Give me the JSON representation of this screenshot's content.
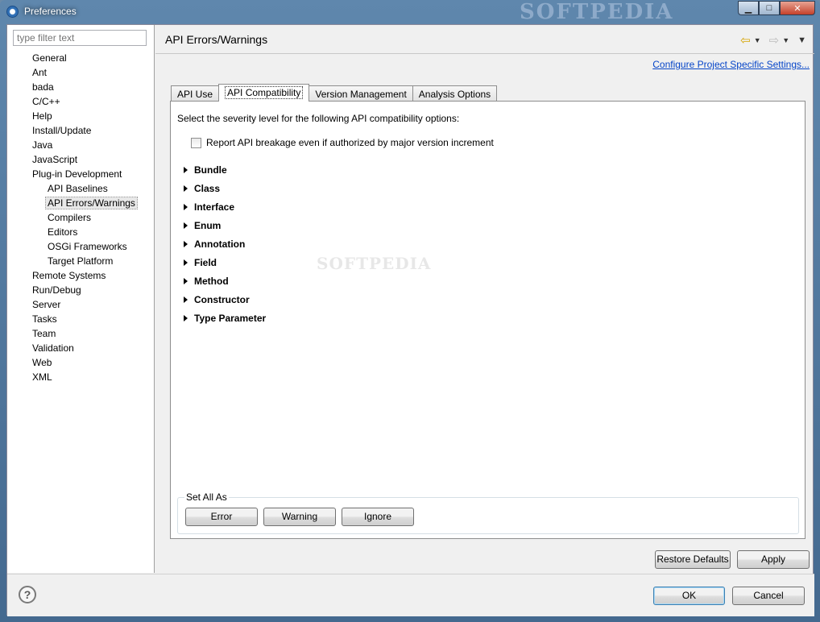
{
  "window": {
    "title": "Preferences",
    "watermark": "SOFTPEDIA",
    "minimize_glyph": "▁",
    "maximize_glyph": "□",
    "close_glyph": "✕"
  },
  "sidebar": {
    "filter_placeholder": "type filter text",
    "items": [
      {
        "label": "General",
        "level": 0
      },
      {
        "label": "Ant",
        "level": 0
      },
      {
        "label": "bada",
        "level": 0
      },
      {
        "label": "C/C++",
        "level": 0
      },
      {
        "label": "Help",
        "level": 0
      },
      {
        "label": "Install/Update",
        "level": 0
      },
      {
        "label": "Java",
        "level": 0
      },
      {
        "label": "JavaScript",
        "level": 0
      },
      {
        "label": "Plug-in Development",
        "level": 0
      },
      {
        "label": "API Baselines",
        "level": 1
      },
      {
        "label": "API Errors/Warnings",
        "level": 1,
        "selected": true
      },
      {
        "label": "Compilers",
        "level": 1
      },
      {
        "label": "Editors",
        "level": 1
      },
      {
        "label": "OSGi Frameworks",
        "level": 1
      },
      {
        "label": "Target Platform",
        "level": 1
      },
      {
        "label": "Remote Systems",
        "level": 0
      },
      {
        "label": "Run/Debug",
        "level": 0
      },
      {
        "label": "Server",
        "level": 0
      },
      {
        "label": "Tasks",
        "level": 0
      },
      {
        "label": "Team",
        "level": 0
      },
      {
        "label": "Validation",
        "level": 0
      },
      {
        "label": "Web",
        "level": 0
      },
      {
        "label": "XML",
        "level": 0
      }
    ]
  },
  "page": {
    "title": "API Errors/Warnings",
    "config_link": "Configure Project Specific Settings...",
    "nav": {
      "back_icon": "⇦",
      "forward_icon": "⇨",
      "dropdown_glyph": "▼",
      "menu_glyph": "▼"
    },
    "tabs": [
      {
        "label": "API Use",
        "active": false
      },
      {
        "label": "API Compatibility",
        "active": true
      },
      {
        "label": "Version Management",
        "active": false
      },
      {
        "label": "Analysis Options",
        "active": false
      }
    ],
    "description": "Select the severity level for the following API compatibility options:",
    "checkbox_label": "Report API breakage even if authorized by major version increment",
    "checkbox_checked": false,
    "sections": [
      "Bundle",
      "Class",
      "Interface",
      "Enum",
      "Annotation",
      "Field",
      "Method",
      "Constructor",
      "Type Parameter"
    ],
    "set_all": {
      "legend": "Set All As",
      "buttons": [
        "Error",
        "Warning",
        "Ignore"
      ]
    },
    "restore_defaults": "Restore Defaults",
    "apply": "Apply"
  },
  "footer": {
    "help_glyph": "?",
    "ok": "OK",
    "cancel": "Cancel"
  }
}
